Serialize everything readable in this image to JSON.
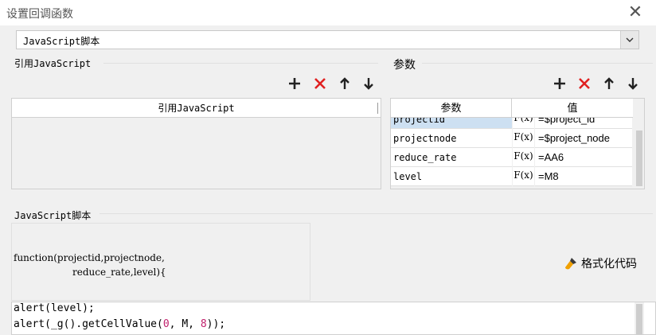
{
  "dialog": {
    "title": "设置回调函数"
  },
  "selector": {
    "value": "JavaScript脚本"
  },
  "ref_js": {
    "label": "引用JavaScript",
    "column_header": "引用JavaScript"
  },
  "params": {
    "label": "参数",
    "header_name": "参数",
    "header_value": "值",
    "fx_label": "F(x)",
    "rows": [
      {
        "name": "projectid",
        "value": "=$project_id"
      },
      {
        "name": "projectnode",
        "value": "=$project_node"
      },
      {
        "name": "reduce_rate",
        "value": "=AA6"
      },
      {
        "name": "level",
        "value": "=M8"
      }
    ]
  },
  "script": {
    "label": "JavaScript脚本",
    "signature_line1": "function(projectid,projectnode,",
    "signature_line2": "reduce_rate,level){",
    "format_label": "格式化代码",
    "code_line1": "alert(level);",
    "code_line2_pre": "alert(_g().getCellValue(",
    "code_line2_n1": "0",
    "code_line2_mid": ", M, ",
    "code_line2_n2": "8",
    "code_line2_post": "));"
  },
  "colors": {
    "delete": "#e02020",
    "number": "#c01f6b"
  }
}
